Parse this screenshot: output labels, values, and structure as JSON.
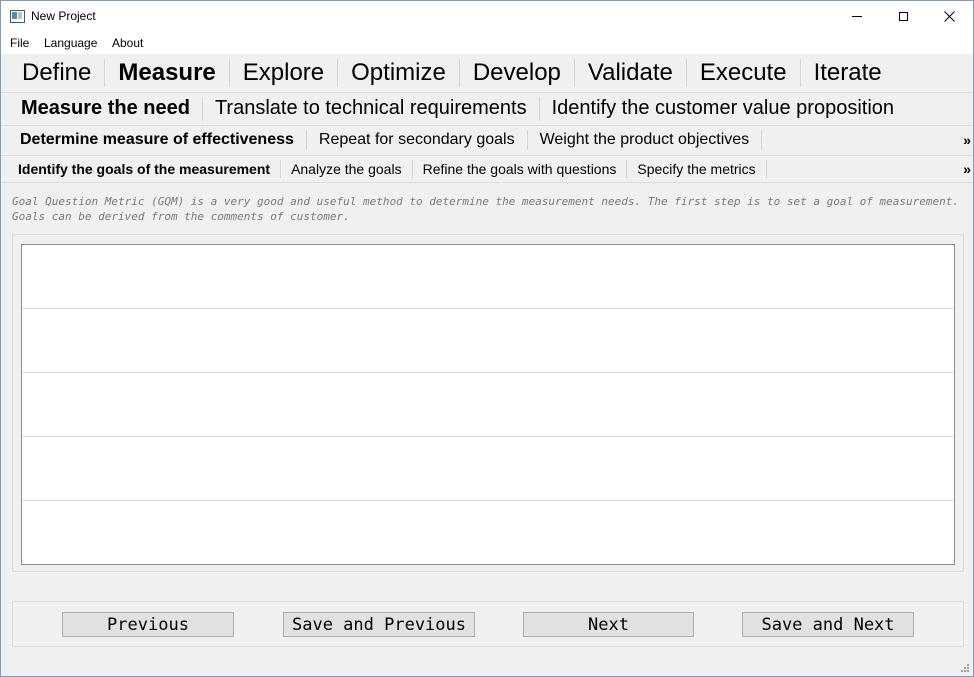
{
  "window": {
    "title": "New Project"
  },
  "icons": {
    "app": "app-window-icon",
    "minimize": "minimize-icon",
    "maximize": "maximize-icon",
    "close": "close-icon",
    "scroll_right": "double-chevron-right-icon",
    "resize_grip": "resize-grip-icon"
  },
  "menu": {
    "file": "File",
    "language": "Language",
    "about": "About"
  },
  "phases": {
    "define": "Define",
    "measure": "Measure",
    "explore": "Explore",
    "optimize": "Optimize",
    "develop": "Develop",
    "validate": "Validate",
    "execute": "Execute",
    "iterate": "Iterate",
    "active": "Measure"
  },
  "steps": {
    "measure_need": "Measure the need",
    "translate": "Translate to technical requirements",
    "value_prop": "Identify the customer value proposition",
    "active": "Measure the need"
  },
  "substeps": {
    "effectiveness": "Determine measure of effectiveness",
    "secondary": "Repeat for secondary goals",
    "weight": "Weight the product objectives",
    "active": "Determine measure of effectiveness",
    "scroll_glyph": "»"
  },
  "tasks": {
    "identify_goals": "Identify the goals of the measurement",
    "analyze": "Analyze the goals",
    "refine": "Refine the goals with questions",
    "metrics": "Specify the metrics",
    "active": "Identify the goals of the measurement",
    "scroll_glyph": "»"
  },
  "description": "Goal Question Metric (GQM) is a very good and useful method to determine the measurement needs. The first step is to set a goal of measurement. Goals can be derived from the comments of customer.",
  "table": {
    "rows": [
      "",
      "",
      "",
      "",
      ""
    ]
  },
  "buttons": {
    "previous": "Previous",
    "save_previous": "Save and Previous",
    "next": "Next",
    "save_next": "Save and Next"
  }
}
